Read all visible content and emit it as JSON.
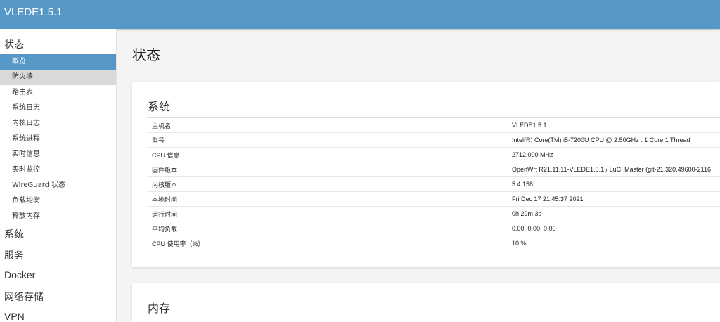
{
  "header": {
    "brand": "VLEDE1.5.1"
  },
  "sidebar": {
    "status": {
      "label": "状态",
      "items": [
        {
          "label": "概览"
        },
        {
          "label": "防火墙"
        },
        {
          "label": "路由表"
        },
        {
          "label": "系统日志"
        },
        {
          "label": "内核日志"
        },
        {
          "label": "系统进程"
        },
        {
          "label": "实时信息"
        },
        {
          "label": "实时监控"
        },
        {
          "label": "WireGuard 状态"
        },
        {
          "label": "负载均衡"
        },
        {
          "label": "释放内存"
        }
      ]
    },
    "menus": [
      {
        "label": "系统"
      },
      {
        "label": "服务"
      },
      {
        "label": "Docker"
      },
      {
        "label": "网络存储"
      },
      {
        "label": "VPN"
      }
    ]
  },
  "main": {
    "title": "状态",
    "system": {
      "title": "系统",
      "rows": [
        {
          "key": "主机名",
          "value": "VLEDE1.5.1"
        },
        {
          "key": "型号",
          "value": "Intel(R) Core(TM) i5-7200U CPU @ 2.50GHz : 1 Core 1 Thread"
        },
        {
          "key": "CPU 信息",
          "value": "2712.000 MHz"
        },
        {
          "key": "固件版本",
          "value": "OpenWrt R21.11.11-VLEDE1.5.1 / LuCI Master (git-21.320.49600-2116"
        },
        {
          "key": "内核版本",
          "value": "5.4.158"
        },
        {
          "key": "本地时间",
          "value": "Fri Dec 17 21:45:37 2021"
        },
        {
          "key": "运行时间",
          "value": "0h 29m 3s"
        },
        {
          "key": "平均负载",
          "value": "0.00, 0.00, 0.00"
        },
        {
          "key": "CPU 使用率（%）",
          "value": "10 %"
        }
      ]
    },
    "memory": {
      "title": "内存"
    }
  }
}
